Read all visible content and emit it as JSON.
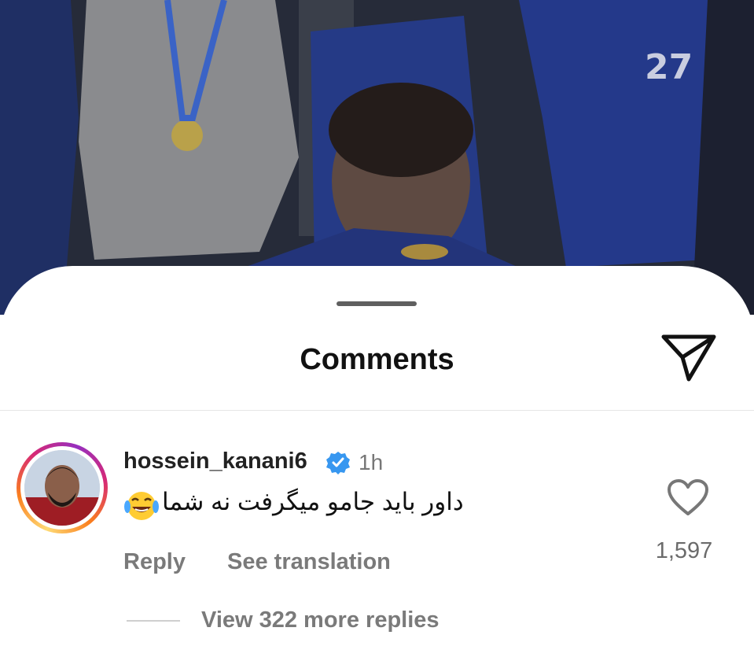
{
  "sheet": {
    "title": "Comments"
  },
  "comment": {
    "username": "hossein_kanani6",
    "time": "1h",
    "text": "داور باید جامو میگرفت نه شما",
    "likes": "1,597",
    "reply_label": "Reply",
    "translation_label": "See translation",
    "more_replies_label": "View 322 more replies"
  },
  "icons": {
    "send": "send-icon",
    "heart": "heart-icon",
    "verified": "verified-badge-icon",
    "emoji": "laughing-tears-emoji"
  },
  "colors": {
    "verified": "#3797f0",
    "muted_text": "#7a7a7a"
  }
}
